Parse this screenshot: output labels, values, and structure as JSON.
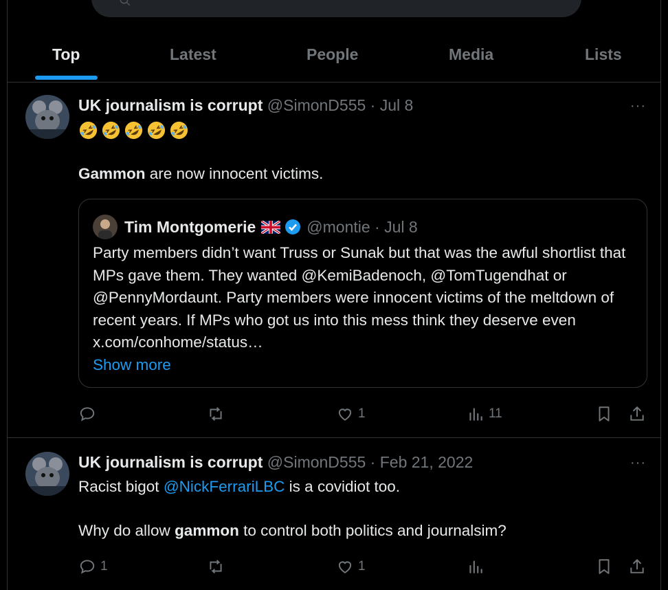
{
  "tabs": [
    {
      "label": "Top",
      "active": true
    },
    {
      "label": "Latest",
      "active": false
    },
    {
      "label": "People",
      "active": false
    },
    {
      "label": "Media",
      "active": false
    },
    {
      "label": "Lists",
      "active": false
    }
  ],
  "tweets": [
    {
      "name": "UK journalism is corrupt",
      "meta": "@SimonD555 · Jul 8",
      "more": "···",
      "emoji_count": 5,
      "emoji": "🤣🤣🤣🤣🤣",
      "body_bold": "Gammon",
      "body_rest": " are now innocent victims.",
      "quote": {
        "name": "Tim Montgomerie",
        "meta": "@montie · Jul 8",
        "text": "Party members didn’t want Truss or Sunak but that was the awful shortlist that MPs gave them. They wanted @KemiBadenoch, @TomTugendhat or @PennyMordaunt. Party members were innocent victims of the meltdown of recent years. If MPs who got us into this mess think they deserve even x.com/conhome/status…",
        "show_more": "Show more"
      },
      "actions": {
        "replies": "",
        "retweets": "",
        "likes": "1",
        "views": "11"
      }
    },
    {
      "name": "UK journalism is corrupt",
      "meta": "@SimonD555 · Feb 21, 2022",
      "more": "···",
      "line1_pre": "Racist bigot ",
      "line1_link": "@NickFerrariLBC",
      "line1_post": " is a covidiot too.",
      "line2_pre": "Why do allow ",
      "line2_bold": "gammon",
      "line2_post": " to control both politics and journalsim?",
      "actions": {
        "replies": "1",
        "retweets": "",
        "likes": "1",
        "views": ""
      }
    }
  ],
  "colors": {
    "accent": "#1d9bf0",
    "muted": "#71767b",
    "border": "#2f3336",
    "bg": "#000000"
  }
}
